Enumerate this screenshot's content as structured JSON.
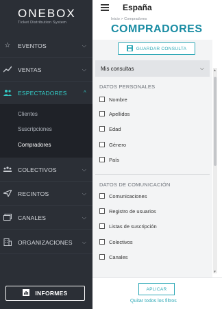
{
  "brand": {
    "name": "ONEBOX",
    "tagline": "Ticket Distribution System"
  },
  "sidebar": {
    "items": [
      {
        "label": "EVENTOS",
        "icon": "star-icon"
      },
      {
        "label": "VENTAS",
        "icon": "trend-icon"
      },
      {
        "label": "ESPECTADORES",
        "icon": "users-icon",
        "active": true
      },
      {
        "label": "COLECTIVOS",
        "icon": "groups-icon"
      },
      {
        "label": "RECINTOS",
        "icon": "send-icon"
      },
      {
        "label": "CANALES",
        "icon": "window-icon"
      },
      {
        "label": "ORGANIZACIONES",
        "icon": "building-icon"
      }
    ],
    "submenu": [
      "Clientes",
      "Suscripciones",
      "Compradores"
    ],
    "reports_label": "INFORMES"
  },
  "header": {
    "country": "España"
  },
  "breadcrumb": "Inicio > Compradores",
  "page_title": "COMPRADORES",
  "filters": {
    "save_label": "GUARDAR CONSULTA",
    "queries_label": "Mis consultas",
    "sections": [
      {
        "title": "DATOS PERSONALES",
        "options": [
          "Nombre",
          "Apellidos",
          "Edad",
          "Género",
          "País"
        ]
      },
      {
        "title": "DATOS DE COMUNICACIÓN",
        "options": [
          "Comunicaciones",
          "Registro de usuarios",
          "Listas de suscripción",
          "Colectivos",
          "Canales"
        ]
      }
    ],
    "apply_label": "APLICAR",
    "clear_label": "Quitar todos los filtros"
  },
  "colors": {
    "accent": "#2aa7b5",
    "sidebar": "#2b2f36",
    "active": "#33c9c4"
  }
}
